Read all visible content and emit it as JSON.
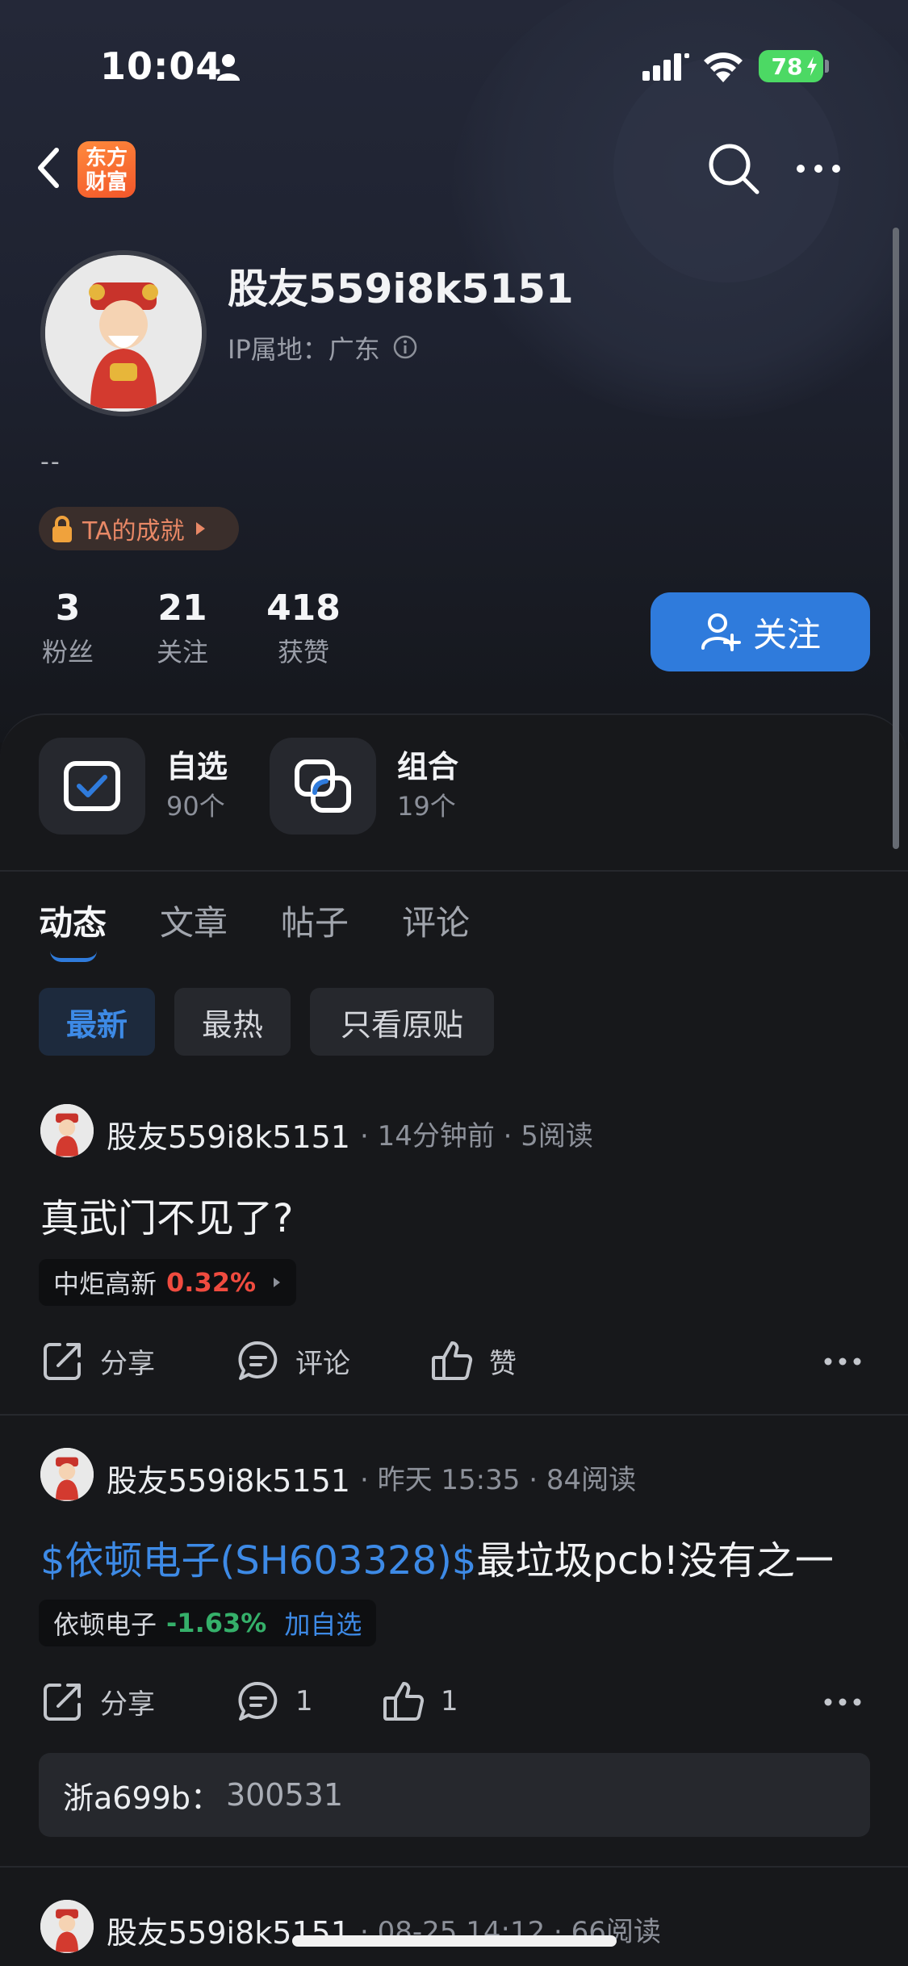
{
  "status_bar": {
    "time": "10:04",
    "battery": "78"
  },
  "nav": {
    "logo_line1": "东方",
    "logo_line2": "财富"
  },
  "profile": {
    "username": "股友559i8k5151",
    "ip_location": "IP属地：广东",
    "bio": "--",
    "achievement_label": "TA的成就",
    "stats": [
      {
        "value": "3",
        "label": "粉丝"
      },
      {
        "value": "21",
        "label": "关注"
      },
      {
        "value": "418",
        "label": "获赞"
      }
    ],
    "follow_label": "关注"
  },
  "quick_tiles": [
    {
      "title": "自选",
      "sub": "90个"
    },
    {
      "title": "组合",
      "sub": "19个"
    }
  ],
  "tabs": [
    "动态",
    "文章",
    "帖子",
    "评论"
  ],
  "filters": [
    "最新",
    "最热",
    "只看原贴"
  ],
  "posts": [
    {
      "author": "股友559i8k5151",
      "meta": "· 14分钟前 · 5阅读",
      "text": "真武门不见了?",
      "stock_name": "中炬高新",
      "stock_pct": "0.32%",
      "actions": {
        "share": "分享",
        "comment": "评论",
        "like": "赞"
      }
    },
    {
      "author": "股友559i8k5151",
      "meta": "· 昨天 15:35 · 84阅读",
      "text_link": "$依顿电子(SH603328)$",
      "text_rest": "最垃圾pcb!没有之一",
      "stock_name": "依顿电子",
      "stock_pct": "-1.63%",
      "add_watch": "加自选",
      "actions": {
        "share": "分享",
        "comment": "1",
        "like": "1"
      },
      "comment_user": "浙a699b：",
      "comment_text": "300531"
    },
    {
      "author": "股友559i8k5151",
      "meta": "· 08-25 14:12 · 66阅读"
    }
  ]
}
